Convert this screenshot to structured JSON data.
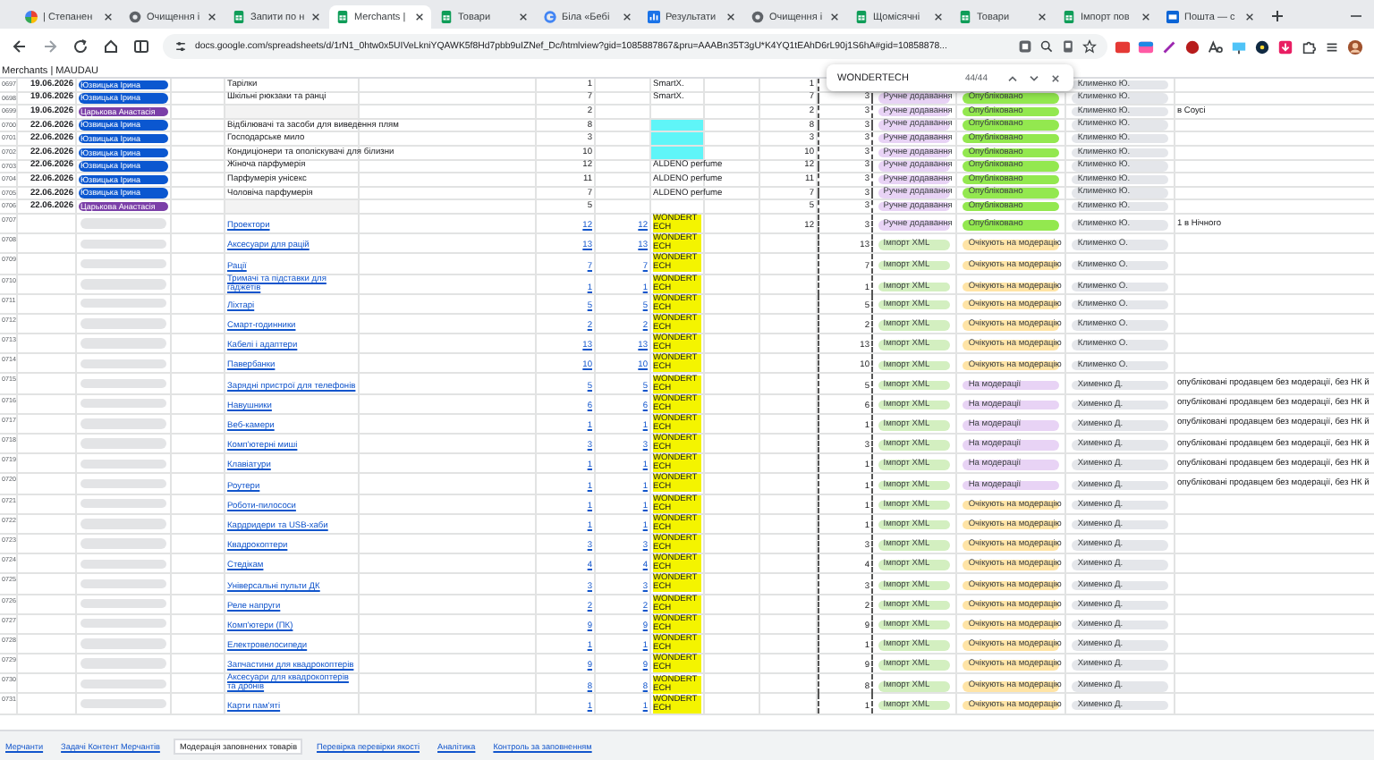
{
  "browser_tabs": [
    {
      "title": "| Степанен",
      "kind": "pinwheel",
      "selected": false
    },
    {
      "title": "Очищення і",
      "kind": "globe",
      "selected": false
    },
    {
      "title": "Запити по н",
      "kind": "sheets",
      "selected": false
    },
    {
      "title": "Merchants |",
      "kind": "sheets",
      "selected": true
    },
    {
      "title": "Товари",
      "kind": "sheets",
      "selected": false
    },
    {
      "title": "Біла «Бебі",
      "kind": "google",
      "selected": false
    },
    {
      "title": "Результати",
      "kind": "report",
      "selected": false
    },
    {
      "title": "Очищення і",
      "kind": "globe",
      "selected": false
    },
    {
      "title": "Щомісячні",
      "kind": "sheets",
      "selected": false
    },
    {
      "title": "Товари",
      "kind": "sheets",
      "selected": false
    },
    {
      "title": "Імпорт пов",
      "kind": "sheets",
      "selected": false
    },
    {
      "title": "Пошта — с",
      "kind": "mail",
      "selected": false
    }
  ],
  "address": "docs.google.com/spreadsheets/d/1rN1_0htw0x5UIVeLkniYQAWK5f8Hd7pbb9uIZNef_Dc/htmlview?gid=1085887867&pru=AAABn35T3gU*K4YQ1tEAhD6rL90j1S6hA#gid=10858878...",
  "sheet_title": "Merchants | MAUDAU",
  "find_bar": {
    "query": "WONDERTECH",
    "count": "44/44"
  },
  "rows": [
    {
      "kind": "short",
      "n": "0697",
      "date": "19.06.2026",
      "person": {
        "kind": "chip",
        "name": "Юзвицька Ірина",
        "color": "#0b57d0"
      },
      "name": "Тарілки",
      "q1": "1",
      "supplier": {
        "kind": "plain",
        "text": "SmartX."
      },
      "q3": "1",
      "manager": "Клименко Ю."
    },
    {
      "kind": "short",
      "n": "0698",
      "date": "19.06.2026",
      "person": {
        "kind": "chip",
        "name": "Юзвицька Ірина",
        "color": "#0b57d0"
      },
      "name": "Шкільні рюкзаки та ранці",
      "q1": "7",
      "supplier": {
        "kind": "plain",
        "text": "SmartX."
      },
      "q3": "7",
      "q4": "3",
      "source": {
        "label": "Ручне додавання",
        "color": "#e8d3f5"
      },
      "status": {
        "label": "Опубліковано",
        "color": "#93e84f"
      },
      "manager": "Клименко Ю."
    },
    {
      "kind": "short",
      "n": "0699",
      "date": "19.06.2026",
      "person": {
        "kind": "chip",
        "name": "Царькова Анастасія",
        "color": "#7b3fa8"
      },
      "q1": "2",
      "q3": "2",
      "q4": "3",
      "source": {
        "label": "Ручне додавання",
        "color": "#e8d3f5"
      },
      "status": {
        "label": "Опубліковано",
        "color": "#93e84f"
      },
      "manager": "Клименко Ю.",
      "note": "в Соусі"
    },
    {
      "kind": "short",
      "n": "0700",
      "date": "22.06.2026",
      "person": {
        "kind": "chip",
        "name": "Юзвицька Ірина",
        "color": "#0b57d0"
      },
      "name": "Відбілювачі та засоби для виведення плям",
      "q1": "8",
      "supplier": {
        "kind": "fill"
      },
      "q3": "8",
      "q4": "3",
      "source": {
        "label": "Ручне додавання",
        "color": "#e8d3f5"
      },
      "status": {
        "label": "Опубліковано",
        "color": "#93e84f"
      },
      "manager": "Клименко Ю."
    },
    {
      "kind": "short",
      "n": "0701",
      "date": "22.06.2026",
      "person": {
        "kind": "chip",
        "name": "Юзвицька Ірина",
        "color": "#0b57d0"
      },
      "name": "Господарське мило",
      "q1": "3",
      "supplier": {
        "kind": "fill"
      },
      "q3": "3",
      "q4": "3",
      "source": {
        "label": "Ручне додавання",
        "color": "#e8d3f5"
      },
      "status": {
        "label": "Опубліковано",
        "color": "#93e84f"
      },
      "manager": "Клименко Ю."
    },
    {
      "kind": "short",
      "n": "0702",
      "date": "22.06.2026",
      "person": {
        "kind": "chip",
        "name": "Юзвицька Ірина",
        "color": "#0b57d0"
      },
      "name": "Кондиціонери та ополіскувачі для білизни",
      "q1": "10",
      "supplier": {
        "kind": "fill"
      },
      "q3": "10",
      "q4": "3",
      "source": {
        "label": "Ручне додавання",
        "color": "#e8d3f5"
      },
      "status": {
        "label": "Опубліковано",
        "color": "#93e84f"
      },
      "manager": "Клименко Ю."
    },
    {
      "kind": "short",
      "n": "0703",
      "date": "22.06.2026",
      "person": {
        "kind": "chip",
        "name": "Юзвицька Ірина",
        "color": "#0b57d0"
      },
      "name": "Жіноча парфумерія",
      "q1": "12",
      "supplier": {
        "kind": "plain",
        "text": "ALDENO perfume"
      },
      "q3": "12",
      "q4": "3",
      "source": {
        "label": "Ручне додавання",
        "color": "#e8d3f5"
      },
      "status": {
        "label": "Опубліковано",
        "color": "#93e84f"
      },
      "manager": "Клименко Ю."
    },
    {
      "kind": "short",
      "n": "0704",
      "date": "22.06.2026",
      "person": {
        "kind": "chip",
        "name": "Юзвицька Ірина",
        "color": "#0b57d0"
      },
      "name": "Парфумерія унісекс",
      "q1": "11",
      "supplier": {
        "kind": "plain",
        "text": "ALDENO perfume"
      },
      "q3": "11",
      "q4": "3",
      "source": {
        "label": "Ручне додавання",
        "color": "#e8d3f5"
      },
      "status": {
        "label": "Опубліковано",
        "color": "#93e84f"
      },
      "manager": "Клименко Ю."
    },
    {
      "kind": "short",
      "n": "0705",
      "date": "22.06.2026",
      "person": {
        "kind": "chip",
        "name": "Юзвицька Ірина",
        "color": "#0b57d0"
      },
      "name": "Чоловіча парфумерія",
      "q1": "7",
      "supplier": {
        "kind": "plain",
        "text": "ALDENO perfume"
      },
      "q3": "7",
      "q4": "3",
      "source": {
        "label": "Ручне додавання",
        "color": "#e8d3f5"
      },
      "status": {
        "label": "Опубліковано",
        "color": "#93e84f"
      },
      "manager": "Клименко Ю."
    },
    {
      "kind": "short",
      "n": "0706",
      "date": "22.06.2026",
      "person": {
        "kind": "chip",
        "name": "Царькова Анастасія",
        "color": "#7b3fa8"
      },
      "q1": "5",
      "q3": "5",
      "q4": "3",
      "source": {
        "label": "Ручне додавання",
        "color": "#e8d3f5"
      },
      "status": {
        "label": "Опубліковано",
        "color": "#93e84f"
      },
      "manager": "Клименко Ю."
    },
    {
      "kind": "tall",
      "n": "0707",
      "person": {
        "kind": "blank"
      },
      "name": "Проектори",
      "q1": "12",
      "q2": "12",
      "supplier": {
        "kind": "match",
        "text": "WONDERTECH"
      },
      "q3": "12",
      "q4": "3",
      "source": {
        "label": "Ручне додавання",
        "color": "#e8d3f5"
      },
      "status": {
        "label": "Опубліковано",
        "color": "#93e84f"
      },
      "manager": "Клименко Ю.",
      "note": "1 в Нічного"
    },
    {
      "kind": "tall",
      "n": "0708",
      "person": {
        "kind": "blank"
      },
      "name": "Аксесуари для рацій",
      "q1": "13",
      "q2": "13",
      "supplier": {
        "kind": "match",
        "text": "WONDERTECH"
      },
      "q4": "13",
      "source": {
        "label": "Імпорт XML",
        "color": "#d3efc0"
      },
      "status": {
        "label": "Очікують на модерацію",
        "color": "#ffe4a6"
      },
      "manager": "Клименко О."
    },
    {
      "kind": "tall",
      "n": "0709",
      "person": {
        "kind": "blank"
      },
      "name": "Рації",
      "q1": "7",
      "q2": "7",
      "supplier": {
        "kind": "match",
        "text": "WONDERTECH"
      },
      "q4": "7",
      "source": {
        "label": "Імпорт XML",
        "color": "#d3efc0"
      },
      "status": {
        "label": "Очікують на модерацію",
        "color": "#ffe4a6"
      },
      "manager": "Клименко О."
    },
    {
      "kind": "tall",
      "n": "0710",
      "person": {
        "kind": "blank"
      },
      "name": "Тримачі та підставки для гаджетів",
      "q1": "1",
      "q2": "1",
      "supplier": {
        "kind": "match",
        "text": "WONDERTECH"
      },
      "q4": "1",
      "source": {
        "label": "Імпорт XML",
        "color": "#d3efc0"
      },
      "status": {
        "label": "Очікують на модерацію",
        "color": "#ffe4a6"
      },
      "manager": "Клименко О."
    },
    {
      "kind": "tall",
      "n": "0711",
      "person": {
        "kind": "blank"
      },
      "name": "Ліхтарі",
      "q1": "5",
      "q2": "5",
      "supplier": {
        "kind": "match",
        "text": "WONDERTECH"
      },
      "q4": "5",
      "source": {
        "label": "Імпорт XML",
        "color": "#d3efc0"
      },
      "status": {
        "label": "Очікують на модерацію",
        "color": "#ffe4a6"
      },
      "manager": "Клименко О."
    },
    {
      "kind": "tall",
      "n": "0712",
      "person": {
        "kind": "blank"
      },
      "name": "Смарт-годинники",
      "q1": "2",
      "q2": "2",
      "supplier": {
        "kind": "match",
        "text": "WONDERTECH"
      },
      "q4": "2",
      "source": {
        "label": "Імпорт XML",
        "color": "#d3efc0"
      },
      "status": {
        "label": "Очікують на модерацію",
        "color": "#ffe4a6"
      },
      "manager": "Клименко О."
    },
    {
      "kind": "tall",
      "n": "0713",
      "person": {
        "kind": "blank"
      },
      "name": "Кабелі і адаптери",
      "q1": "13",
      "q2": "13",
      "supplier": {
        "kind": "match",
        "text": "WONDERTECH"
      },
      "q4": "13",
      "source": {
        "label": "Імпорт XML",
        "color": "#d3efc0"
      },
      "status": {
        "label": "Очікують на модерацію",
        "color": "#ffe4a6"
      },
      "manager": "Клименко О."
    },
    {
      "kind": "tall",
      "n": "0714",
      "person": {
        "kind": "blank"
      },
      "name": "Павербанки",
      "q1": "10",
      "q2": "10",
      "supplier": {
        "kind": "match",
        "text": "WONDERTECH"
      },
      "q4": "10",
      "source": {
        "label": "Імпорт XML",
        "color": "#d3efc0"
      },
      "status": {
        "label": "Очікують на модерацію",
        "color": "#ffe4a6"
      },
      "manager": "Клименко О."
    },
    {
      "kind": "tall",
      "n": "0715",
      "person": {
        "kind": "blank"
      },
      "name": "Зарядні пристрої для телефонів",
      "q1": "5",
      "q2": "5",
      "supplier": {
        "kind": "match",
        "text": "WONDERTECH"
      },
      "q4": "5",
      "source": {
        "label": "Імпорт XML",
        "color": "#d3efc0"
      },
      "status": {
        "label": "На модерації",
        "color": "#e8d3f5"
      },
      "manager": "Хименко Д.",
      "note": "опубліковані продавцем без модерації, без НК й"
    },
    {
      "kind": "tall",
      "n": "0716",
      "person": {
        "kind": "blank"
      },
      "name": "Навушники",
      "q1": "6",
      "q2": "6",
      "supplier": {
        "kind": "match",
        "text": "WONDERTECH"
      },
      "q4": "6",
      "source": {
        "label": "Імпорт XML",
        "color": "#d3efc0"
      },
      "status": {
        "label": "На модерації",
        "color": "#e8d3f5"
      },
      "manager": "Хименко Д.",
      "note": "опубліковані продавцем без модерації, без НК й"
    },
    {
      "kind": "tall",
      "n": "0717",
      "person": {
        "kind": "blank"
      },
      "name": "Веб-камери",
      "q1": "1",
      "q2": "1",
      "supplier": {
        "kind": "match",
        "text": "WONDERTECH"
      },
      "q4": "1",
      "source": {
        "label": "Імпорт XML",
        "color": "#d3efc0"
      },
      "status": {
        "label": "На модерації",
        "color": "#e8d3f5"
      },
      "manager": "Хименко Д.",
      "note": "опубліковані продавцем без модерації, без НК й"
    },
    {
      "kind": "tall",
      "n": "0718",
      "person": {
        "kind": "blank"
      },
      "name": "Комп'ютерні миші",
      "q1": "3",
      "q2": "3",
      "supplier": {
        "kind": "match",
        "text": "WONDERTECH"
      },
      "q4": "3",
      "source": {
        "label": "Імпорт XML",
        "color": "#d3efc0"
      },
      "status": {
        "label": "На модерації",
        "color": "#e8d3f5"
      },
      "manager": "Хименко Д.",
      "note": "опубліковані продавцем без модерації, без НК й"
    },
    {
      "kind": "tall",
      "n": "0719",
      "person": {
        "kind": "blank"
      },
      "name": "Клавіатури",
      "q1": "1",
      "q2": "1",
      "supplier": {
        "kind": "match",
        "text": "WONDERTECH"
      },
      "q4": "1",
      "source": {
        "label": "Імпорт XML",
        "color": "#d3efc0"
      },
      "status": {
        "label": "На модерації",
        "color": "#e8d3f5"
      },
      "manager": "Хименко Д.",
      "note": "опубліковані продавцем без модерації, без НК й"
    },
    {
      "kind": "tall",
      "n": "0720",
      "person": {
        "kind": "blank"
      },
      "name": "Роутери",
      "q1": "1",
      "q2": "1",
      "supplier": {
        "kind": "match",
        "text": "WONDERTECH"
      },
      "q4": "1",
      "source": {
        "label": "Імпорт XML",
        "color": "#d3efc0"
      },
      "status": {
        "label": "На модерації",
        "color": "#e8d3f5"
      },
      "manager": "Хименко Д.",
      "note": "опубліковані продавцем без модерації, без НК й"
    },
    {
      "kind": "tall",
      "n": "0721",
      "person": {
        "kind": "blank"
      },
      "name": "Роботи-пилососи",
      "q1": "1",
      "q2": "1",
      "supplier": {
        "kind": "match",
        "text": "WONDERTECH"
      },
      "q4": "1",
      "source": {
        "label": "Імпорт XML",
        "color": "#d3efc0"
      },
      "status": {
        "label": "Очікують на модерацію",
        "color": "#ffe4a6"
      },
      "manager": "Хименко Д."
    },
    {
      "kind": "tall",
      "n": "0722",
      "person": {
        "kind": "blank"
      },
      "name": "Кардридери та USB-хаби",
      "q1": "1",
      "q2": "1",
      "supplier": {
        "kind": "match",
        "text": "WONDERTECH"
      },
      "q4": "1",
      "source": {
        "label": "Імпорт XML",
        "color": "#d3efc0"
      },
      "status": {
        "label": "Очікують на модерацію",
        "color": "#ffe4a6"
      },
      "manager": "Хименко Д."
    },
    {
      "kind": "tall",
      "n": "0723",
      "person": {
        "kind": "blank"
      },
      "name": "Квадрокоптери",
      "q1": "3",
      "q2": "3",
      "supplier": {
        "kind": "match",
        "text": "WONDERTECH"
      },
      "q4": "3",
      "source": {
        "label": "Імпорт XML",
        "color": "#d3efc0"
      },
      "status": {
        "label": "Очікують на модерацію",
        "color": "#ffe4a6"
      },
      "manager": "Хименко Д."
    },
    {
      "kind": "tall",
      "n": "0724",
      "person": {
        "kind": "blank"
      },
      "name": "Стедікам",
      "q1": "4",
      "q2": "4",
      "supplier": {
        "kind": "match",
        "text": "WONDERTECH"
      },
      "q4": "4",
      "source": {
        "label": "Імпорт XML",
        "color": "#d3efc0"
      },
      "status": {
        "label": "Очікують на модерацію",
        "color": "#ffe4a6"
      },
      "manager": "Хименко Д."
    },
    {
      "kind": "tall",
      "n": "0725",
      "person": {
        "kind": "blank"
      },
      "name": "Універсальні пульти ДК",
      "q1": "3",
      "q2": "3",
      "supplier": {
        "kind": "match",
        "text": "WONDERTECH"
      },
      "q4": "3",
      "source": {
        "label": "Імпорт XML",
        "color": "#d3efc0"
      },
      "status": {
        "label": "Очікують на модерацію",
        "color": "#ffe4a6"
      },
      "manager": "Хименко Д."
    },
    {
      "kind": "tall",
      "n": "0726",
      "person": {
        "kind": "blank"
      },
      "name": "Реле напруги",
      "q1": "2",
      "q2": "2",
      "supplier": {
        "kind": "match",
        "text": "WONDERTECH"
      },
      "q4": "2",
      "source": {
        "label": "Імпорт XML",
        "color": "#d3efc0"
      },
      "status": {
        "label": "Очікують на модерацію",
        "color": "#ffe4a6"
      },
      "manager": "Хименко Д."
    },
    {
      "kind": "tall",
      "n": "0727",
      "person": {
        "kind": "blank"
      },
      "name": "Комп'ютери (ПК)",
      "q1": "9",
      "q2": "9",
      "supplier": {
        "kind": "match",
        "text": "WONDERTECH"
      },
      "q4": "9",
      "source": {
        "label": "Імпорт XML",
        "color": "#d3efc0"
      },
      "status": {
        "label": "Очікують на модерацію",
        "color": "#ffe4a6"
      },
      "manager": "Хименко Д."
    },
    {
      "kind": "tall",
      "n": "0728",
      "person": {
        "kind": "blank"
      },
      "name": "Електровелосипеди",
      "q1": "1",
      "q2": "1",
      "supplier": {
        "kind": "match",
        "text": "WONDERTECH"
      },
      "q4": "1",
      "source": {
        "label": "Імпорт XML",
        "color": "#d3efc0"
      },
      "status": {
        "label": "Очікують на модерацію",
        "color": "#ffe4a6"
      },
      "manager": "Хименко Д."
    },
    {
      "kind": "tall",
      "n": "0729",
      "person": {
        "kind": "blank"
      },
      "name": "Запчастини для квадрокоптерів",
      "q1": "9",
      "q2": "9",
      "supplier": {
        "kind": "match",
        "text": "WONDERTECH"
      },
      "q4": "9",
      "source": {
        "label": "Імпорт XML",
        "color": "#d3efc0"
      },
      "status": {
        "label": "Очікують на модерацію",
        "color": "#ffe4a6"
      },
      "manager": "Хименко Д."
    },
    {
      "kind": "tall",
      "n": "0730",
      "person": {
        "kind": "blank"
      },
      "name": "Аксесуари для квадрокоптерів та дронів",
      "q1": "8",
      "q2": "8",
      "supplier": {
        "kind": "match",
        "text": "WONDERTECH"
      },
      "q4": "8",
      "source": {
        "label": "Імпорт XML",
        "color": "#d3efc0"
      },
      "status": {
        "label": "Очікують на модерацію",
        "color": "#ffe4a6"
      },
      "manager": "Хименко Д."
    },
    {
      "kind": "tall",
      "n": "0731",
      "person": {
        "kind": "blank"
      },
      "name": "Карти пам'яті",
      "q1": "1",
      "q2": "1",
      "supplier": {
        "kind": "match",
        "text": "WONDERTECH"
      },
      "q4": "1",
      "source": {
        "label": "Імпорт XML",
        "color": "#d3efc0"
      },
      "status": {
        "label": "Очікують на модерацію",
        "color": "#ffe4a6"
      },
      "manager": "Хименко Д."
    }
  ],
  "sheet_tabs": [
    {
      "label": "Мерчанти",
      "selected": false
    },
    {
      "label": "Задачі Контент Мерчантів",
      "selected": false
    },
    {
      "label": "Модерація заповнених товарів",
      "selected": true
    },
    {
      "label": "Перевірка перевірки якості",
      "selected": false
    },
    {
      "label": "Аналітика",
      "selected": false
    },
    {
      "label": "Контроль за заповненням",
      "selected": false
    }
  ]
}
